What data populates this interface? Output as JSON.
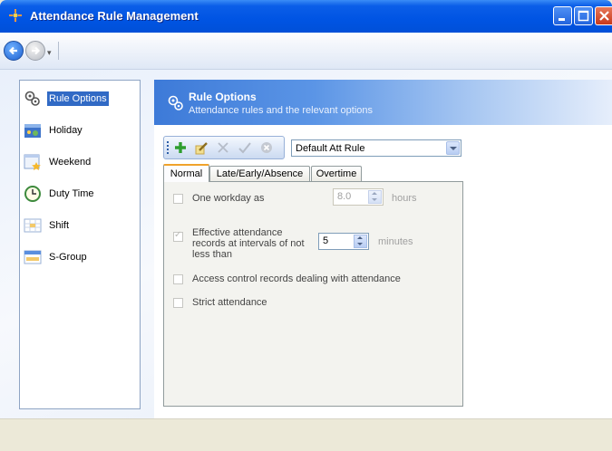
{
  "window": {
    "title": "Attendance Rule Management"
  },
  "nav": {
    "back": "back-icon",
    "forward": "forward-icon",
    "dropdown": "▾"
  },
  "sidebar": {
    "items": [
      {
        "label": "Rule Options",
        "icon": "rule-options-icon",
        "selected": true
      },
      {
        "label": "Holiday",
        "icon": "holiday-icon",
        "selected": false
      },
      {
        "label": "Weekend",
        "icon": "weekend-icon",
        "selected": false
      },
      {
        "label": "Duty Time",
        "icon": "clock-icon",
        "selected": false
      },
      {
        "label": "Shift",
        "icon": "shift-icon",
        "selected": false
      },
      {
        "label": "S-Group",
        "icon": "schedule-group-icon",
        "selected": false
      }
    ]
  },
  "header": {
    "title": "Rule Options",
    "subtitle": "Attendance rules and the relevant options"
  },
  "toolbar": {
    "buttons": [
      "add-icon",
      "edit-icon",
      "delete-icon",
      "confirm-icon",
      "cancel-icon"
    ]
  },
  "rule_select": {
    "value": "Default Att Rule"
  },
  "tabs": [
    {
      "label": "Normal",
      "active": true
    },
    {
      "label": "Late/Early/Absence",
      "active": false
    },
    {
      "label": "Overtime",
      "active": false
    }
  ],
  "options": {
    "workday": {
      "label": "One workday as",
      "checked": false,
      "value": "8.0",
      "unit": "hours"
    },
    "interval": {
      "label": "Effective attendance records at intervals of not less than",
      "checked": true,
      "value": "5",
      "unit": "minutes"
    },
    "access_control": {
      "label": "Access control records dealing with attendance",
      "checked": false
    },
    "strict": {
      "label": "Strict attendance",
      "checked": false
    }
  },
  "colors": {
    "title_bar": "#0054e3",
    "selection": "#316ac5",
    "header_gradient_start": "#3d7ad8",
    "active_tab_accent": "#f0a22b"
  }
}
